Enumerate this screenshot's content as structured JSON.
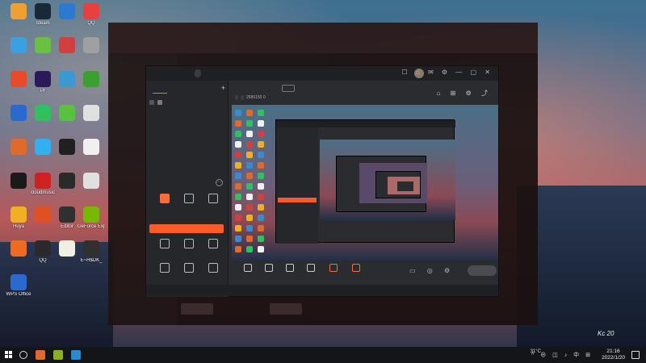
{
  "desktop": {
    "icons": [
      {
        "label": "",
        "color": "#f0a030"
      },
      {
        "label": "Steam",
        "color": "#1b2838"
      },
      {
        "label": "",
        "color": "#2a7ad0"
      },
      {
        "label": "QQ",
        "color": "#e84040"
      },
      {
        "label": "",
        "color": "#3aa0e0"
      },
      {
        "label": "",
        "color": "#6ac040"
      },
      {
        "label": "",
        "color": "#d04040"
      },
      {
        "label": "",
        "color": "#a0a0a0"
      },
      {
        "label": "",
        "color": "#e84a2a"
      },
      {
        "label": "Pr",
        "color": "#2a1a5a"
      },
      {
        "label": "",
        "color": "#3a9ad0"
      },
      {
        "label": "",
        "color": "#3aa030"
      },
      {
        "label": "",
        "color": "#2a6ad0"
      },
      {
        "label": "",
        "color": "#30c060"
      },
      {
        "label": "",
        "color": "#5ac040"
      },
      {
        "label": "",
        "color": "#e0e0e0"
      },
      {
        "label": "",
        "color": "#e06a2a"
      },
      {
        "label": "",
        "color": "#30b0f0"
      },
      {
        "label": "",
        "color": "#202020"
      },
      {
        "label": "",
        "color": "#f0f0f0"
      },
      {
        "label": "",
        "color": "#1a1a1a"
      },
      {
        "label": "cloudmusic",
        "color": "#d02020"
      },
      {
        "label": "",
        "color": "#2a2a2a"
      },
      {
        "label": "",
        "color": "#e0e0e0"
      },
      {
        "label": "Huya",
        "color": "#f0b020"
      },
      {
        "label": "",
        "color": "#e05020"
      },
      {
        "label": "Editor",
        "color": "#303030"
      },
      {
        "label": "GeForce Experience",
        "color": "#76b900"
      },
      {
        "label": "",
        "color": "#f06a20"
      },
      {
        "label": "QQ",
        "color": "#2a2a2a"
      },
      {
        "label": "",
        "color": "#f0f0e0"
      },
      {
        "label": "E~H$DK_",
        "color": "#303030"
      },
      {
        "label": "WPS Office",
        "color": "#2a6ad0"
      }
    ]
  },
  "bg_client": {
    "nav": [
      "",
      "",
      "",
      ""
    ],
    "side": [
      "",
      "",
      "",
      "",
      "",
      "",
      "",
      "",
      "",
      "",
      ""
    ],
    "bottom_buttons": [
      "",
      ""
    ]
  },
  "app": {
    "brand": "",
    "version": "",
    "window_controls": "☐ ⌂ ✉ ⚙ — ▢ ✕",
    "tabs": [
      "",
      "",
      ""
    ],
    "add_scene": "+",
    "scene_label": "",
    "toolbox_label": "",
    "toolbox_more": "···",
    "tools": [
      {
        "label": "",
        "orange": true
      },
      {
        "label": "",
        "orange": false
      },
      {
        "label": "",
        "orange": false
      },
      {
        "label": "",
        "orange": false
      },
      {
        "label": "",
        "orange": false
      },
      {
        "label": "",
        "orange": false
      },
      {
        "label": "",
        "orange": false
      },
      {
        "label": "",
        "orange": false
      },
      {
        "label": "",
        "orange": false
      },
      {
        "label": "",
        "orange": false
      },
      {
        "label": "",
        "orange": false
      },
      {
        "label": "",
        "orange": false
      }
    ],
    "promo_text": "",
    "promo_tag": "",
    "notice": "",
    "room_title": "",
    "edit_label": "",
    "room_meta": {
      "tag1": "",
      "tag2": "",
      "tag3": "",
      "number": "2586150",
      "likes": "0"
    },
    "header_icons": "⌂ ⊞ ⚙ ⤴",
    "bottom_items": [
      {
        "label": "",
        "orange": false
      },
      {
        "label": "",
        "orange": false
      },
      {
        "label": "",
        "orange": false
      },
      {
        "label": "",
        "orange": false
      },
      {
        "label": "",
        "orange": true
      },
      {
        "label": "",
        "orange": true
      }
    ],
    "bottom_extra": "▭ ◎ ⚙",
    "start_live": "",
    "status": [
      "",
      "",
      "",
      "",
      ""
    ]
  },
  "taskbar": {
    "pinned": [
      "#e06a2a",
      "#8ab020",
      "#2a8ad0"
    ],
    "temperature": "31°C",
    "temp_sub": "",
    "tray_symbols": "^ ⊕ ◫ ♪ 中 ⊞",
    "time": "21:16",
    "date": "2022/1/20"
  },
  "watermark": "Kc 20"
}
